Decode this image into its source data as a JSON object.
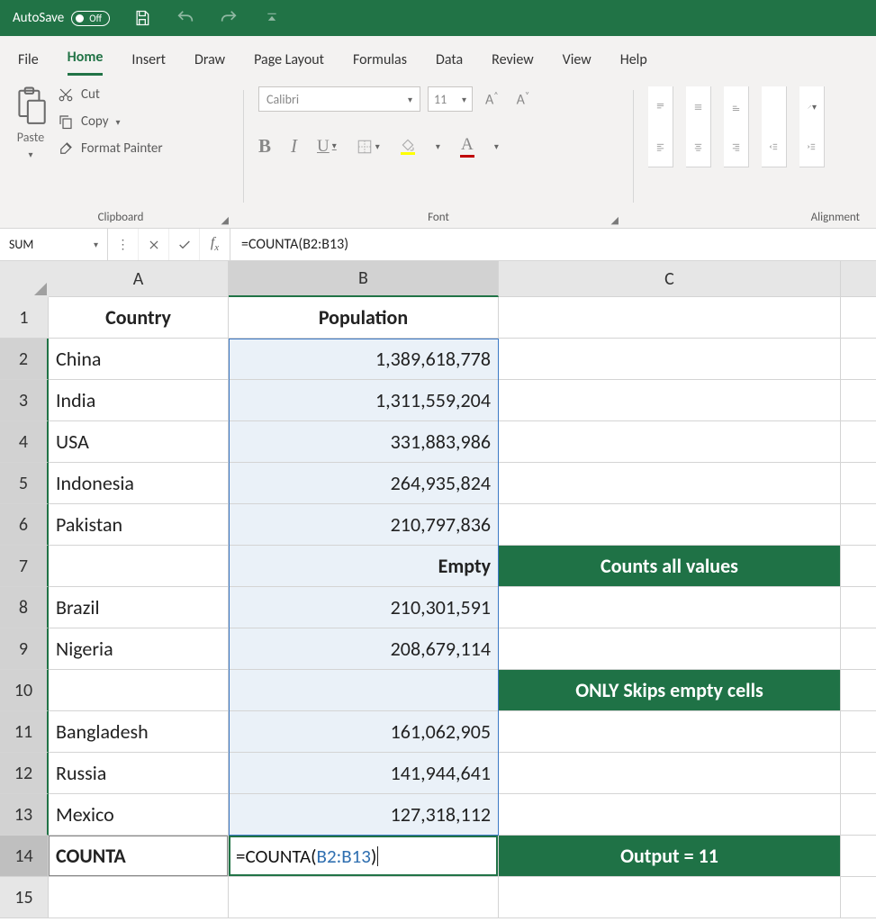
{
  "titlebar": {
    "autosave_label": "AutoSave",
    "autosave_state": "Off"
  },
  "tabs": [
    "File",
    "Home",
    "Insert",
    "Draw",
    "Page Layout",
    "Formulas",
    "Data",
    "Review",
    "View",
    "Help"
  ],
  "active_tab": "Home",
  "ribbon": {
    "clipboard": {
      "paste": "Paste",
      "cut": "Cut",
      "copy": "Copy",
      "format_painter": "Format Painter",
      "group_label": "Clipboard"
    },
    "font": {
      "name": "Calibri",
      "size": "11",
      "group_label": "Font"
    },
    "alignment": {
      "group_label": "Alignment"
    }
  },
  "formula_bar": {
    "name_box": "SUM",
    "formula": "=COUNTA(B2:B13)"
  },
  "columns": [
    "A",
    "B",
    "C"
  ],
  "sheet": {
    "headers": {
      "A": "Country",
      "B": "Population"
    },
    "rows": [
      {
        "n": 2,
        "A": "China",
        "B": "1,389,618,778",
        "C": ""
      },
      {
        "n": 3,
        "A": "India",
        "B": "1,311,559,204",
        "C": ""
      },
      {
        "n": 4,
        "A": "USA",
        "B": "331,883,986",
        "C": ""
      },
      {
        "n": 5,
        "A": "Indonesia",
        "B": "264,935,824",
        "C": ""
      },
      {
        "n": 6,
        "A": "Pakistan",
        "B": "210,797,836",
        "C": ""
      },
      {
        "n": 7,
        "A": "",
        "B": "Empty",
        "C": "Counts all values",
        "B_bold": true,
        "C_green": true
      },
      {
        "n": 8,
        "A": "Brazil",
        "B": "210,301,591",
        "C": ""
      },
      {
        "n": 9,
        "A": "Nigeria",
        "B": "208,679,114",
        "C": ""
      },
      {
        "n": 10,
        "A": "",
        "B": "",
        "C": "ONLY Skips empty cells",
        "C_green": true
      },
      {
        "n": 11,
        "A": "Bangladesh",
        "B": "161,062,905",
        "C": ""
      },
      {
        "n": 12,
        "A": "Russia",
        "B": "141,944,641",
        "C": ""
      },
      {
        "n": 13,
        "A": "Mexico",
        "B": "127,318,112",
        "C": ""
      }
    ],
    "row14": {
      "A": "COUNTA",
      "B_prefix": "=COUNTA(",
      "B_ref": "B2:B13",
      "B_suffix": ")",
      "C": "Output = 11"
    }
  }
}
